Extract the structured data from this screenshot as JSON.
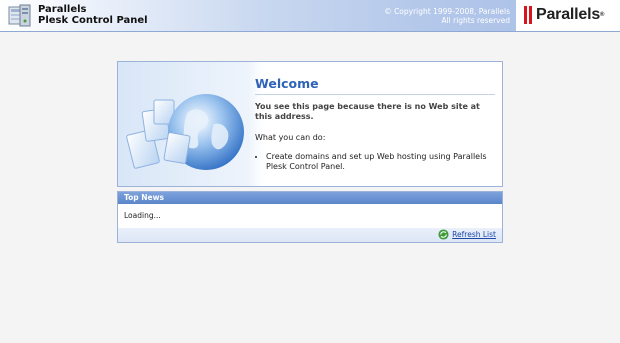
{
  "header": {
    "product_line1": "Parallels",
    "product_line2": "Plesk Control Panel",
    "copyright_line1": "© Copyright 1999-2008, Parallels",
    "copyright_line2": "All rights reserved",
    "logo_text": "Parallels",
    "logo_mark": "®"
  },
  "welcome": {
    "title": "Welcome",
    "message": "You see this page because there is no Web site at this address.",
    "cando": "What you can do:",
    "items": [
      "Create domains and set up Web hosting using Parallels Plesk Control Panel."
    ]
  },
  "news": {
    "title": "Top News",
    "loading": "Loading...",
    "refresh_label": "Refresh List"
  },
  "colors": {
    "accent": "#2e63b7",
    "news_bar": "#5b85c8",
    "logo_red": "#d5161b"
  },
  "icons": [
    "plesk-app-icon",
    "globe-illustration",
    "refresh-icon"
  ]
}
